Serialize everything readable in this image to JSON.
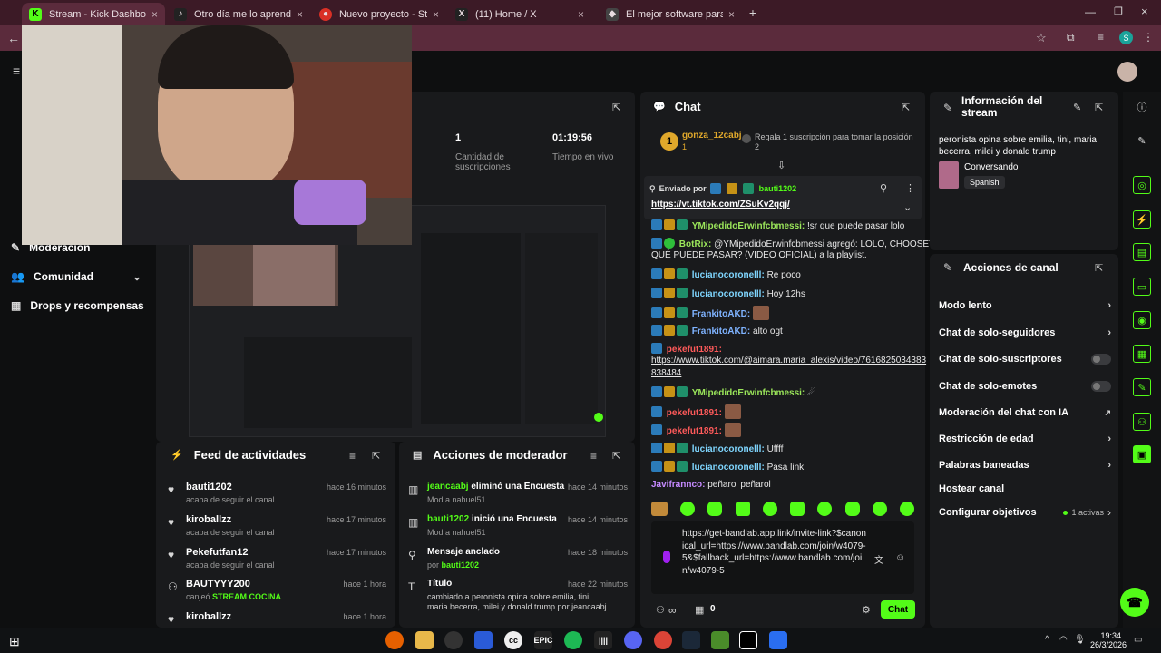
{
  "browser": {
    "tabs": [
      {
        "title": "Stream - Kick Dashboard",
        "icon": "kick-icon",
        "color": "#53fc18",
        "active": true
      },
      {
        "title": "Otro día me lo aprendo ajaj | ju",
        "icon": "tiktok-icon",
        "color": "#222222"
      },
      {
        "title": "Nuevo proyecto - Studio",
        "icon": "studio-icon",
        "color": "#d93025"
      },
      {
        "title": "(11) Home / X",
        "icon": "x-icon",
        "color": "#222222"
      },
      {
        "title": "El mejor software para pote",
        "icon": "web-icon",
        "color": "#444444"
      }
    ],
    "new_tab": "+"
  },
  "sidebar": {
    "items": [
      {
        "label": "Moderación",
        "icon": "wrench-icon"
      },
      {
        "label": "Comunidad",
        "icon": "people-icon"
      },
      {
        "label": "Drops y recompensas",
        "icon": "gift-icon"
      }
    ]
  },
  "stats": {
    "subs_value": "1",
    "subs_label": "Cantidad de suscripciones",
    "live_value": "01:19:56",
    "live_label": "Tiempo en vivo"
  },
  "chat": {
    "title": "Chat",
    "top_gifter": {
      "rank": "1",
      "name": "gonza_12cabj",
      "count": "1"
    },
    "gift_prompt": "Regala 1 suscripción para tomar la posición 2",
    "pinned": {
      "label": "Enviado por",
      "user": "bauti1202",
      "link": "https://vt.tiktok.com/ZSuKv2qqj/"
    },
    "messages": [
      {
        "user": "YMipedidoErwinfcbmessi:",
        "text": "!sr que puede pasar lolo",
        "color": "#9be65a"
      },
      {
        "user": "BotRix:",
        "text": "@YMipedidoErwinfcbmessi agregó: LOLO, CHOOSEY -",
        "color": "#9be65a"
      },
      {
        "user": "",
        "text": "QUÉ PUEDE PASAR? (VIDEO OFICIAL) a la playlist.",
        "color": "#9be65a"
      },
      {
        "user": "lucianocoronelll:",
        "text": "Re poco",
        "color": "#7fd6ff"
      },
      {
        "user": "lucianocoronelll:",
        "text": "Hoy 12hs",
        "color": "#7fd6ff"
      },
      {
        "user": "FrankitoAKD:",
        "text": "",
        "color": "#7fb3ff"
      },
      {
        "user": "FrankitoAKD:",
        "text": "alto ogt",
        "color": "#7fb3ff"
      },
      {
        "user": "pekefut1891:",
        "text": "",
        "color": "#ff5a5a"
      },
      {
        "user": "",
        "text": "https://www.tiktok.com/@aimara.maria_alexis/video/7616825034383",
        "color": "#ff5a5a"
      },
      {
        "user": "",
        "text": "838484",
        "color": "#ff5a5a"
      },
      {
        "user": "YMipedidoErwinfcbmessi:",
        "text": "",
        "color": "#9be65a"
      },
      {
        "user": "pekefut1891:",
        "text": "",
        "color": "#ff5a5a"
      },
      {
        "user": "pekefut1891:",
        "text": "",
        "color": "#ff5a5a"
      },
      {
        "user": "lucianocoronelll:",
        "text": "Uffff",
        "color": "#7fd6ff"
      },
      {
        "user": "lucianocoronelll:",
        "text": "Pasa link",
        "color": "#7fd6ff"
      },
      {
        "user": "Javifrannco:",
        "text": "peñarol peñarol",
        "color": "#c58aff"
      }
    ],
    "input_text": "https://get-bandlab.app.link/invite-link?$canonical_url=https://www.bandlab.com/join/w4079-5&$fallback_url=https://www.bandlab.com/join/w4079-5",
    "points": "0",
    "send_label": "Chat"
  },
  "stream_info": {
    "title": "Información del stream",
    "stream_title": "peronista opina sobre emilia, tini, maria becerra, milei y donald trump",
    "category": "Conversando",
    "language": "Spanish"
  },
  "channel_actions": {
    "title": "Acciones de canal",
    "items": [
      {
        "label": "Modo lento",
        "control": "chevron"
      },
      {
        "label": "Chat de solo-seguidores",
        "control": "chevron"
      },
      {
        "label": "Chat de solo-suscriptores",
        "control": "toggle"
      },
      {
        "label": "Chat de solo-emotes",
        "control": "toggle"
      },
      {
        "label": "Moderación del chat con IA",
        "control": "external"
      },
      {
        "label": "Restricción de edad",
        "control": "chevron"
      },
      {
        "label": "Palabras baneadas",
        "control": "chevron"
      },
      {
        "label": "Hostear canal",
        "control": "none"
      },
      {
        "label": "Configurar objetivos",
        "control": "chevron",
        "extra": "1 activas"
      }
    ]
  },
  "activity_feed": {
    "title": "Feed de actividades",
    "items": [
      {
        "user": "bauti1202",
        "action": "acaba de seguir el canal",
        "time": "hace 16 minutos",
        "icon": "heart-icon"
      },
      {
        "user": "kiroballzz",
        "action": "acaba de seguir el canal",
        "time": "hace 17 minutos",
        "icon": "heart-icon"
      },
      {
        "user": "Pekefutfan12",
        "action": "acaba de seguir el canal",
        "time": "hace 17 minutos",
        "icon": "heart-icon"
      },
      {
        "user": "BAUTYYY200",
        "action": "canjeó",
        "reward": "STREAM COCINA",
        "time": "hace 1 hora",
        "icon": "reward-icon"
      },
      {
        "user": "kiroballzz",
        "action": "",
        "time": "hace 1 hora",
        "icon": "heart-icon"
      }
    ]
  },
  "mod_actions": {
    "title": "Acciones de moderador",
    "items": [
      {
        "user": "jeancaabj",
        "action": "eliminó una Encuesta",
        "sub": "Mod a nahuel51",
        "time": "hace 14 minutos",
        "icon": "poll-icon"
      },
      {
        "user": "bauti1202",
        "action": "inició una Encuesta",
        "sub": "Mod a nahuel51",
        "time": "hace 14 minutos",
        "icon": "poll-icon"
      },
      {
        "user": "",
        "action": "Mensaje anclado",
        "sub_prefix": "por",
        "sub": "bauti1202",
        "time": "hace 18 minutos",
        "icon": "pin-icon"
      },
      {
        "user": "",
        "action": "Título",
        "sub": "cambiado a peronista opina sobre emilia, tini, maria becerra, milei y donald trump por jeancaabj",
        "time": "hace 22 minutos",
        "icon": "title-icon"
      }
    ]
  },
  "taskbar": {
    "clock": "19:34",
    "date": "26/3/2026"
  }
}
